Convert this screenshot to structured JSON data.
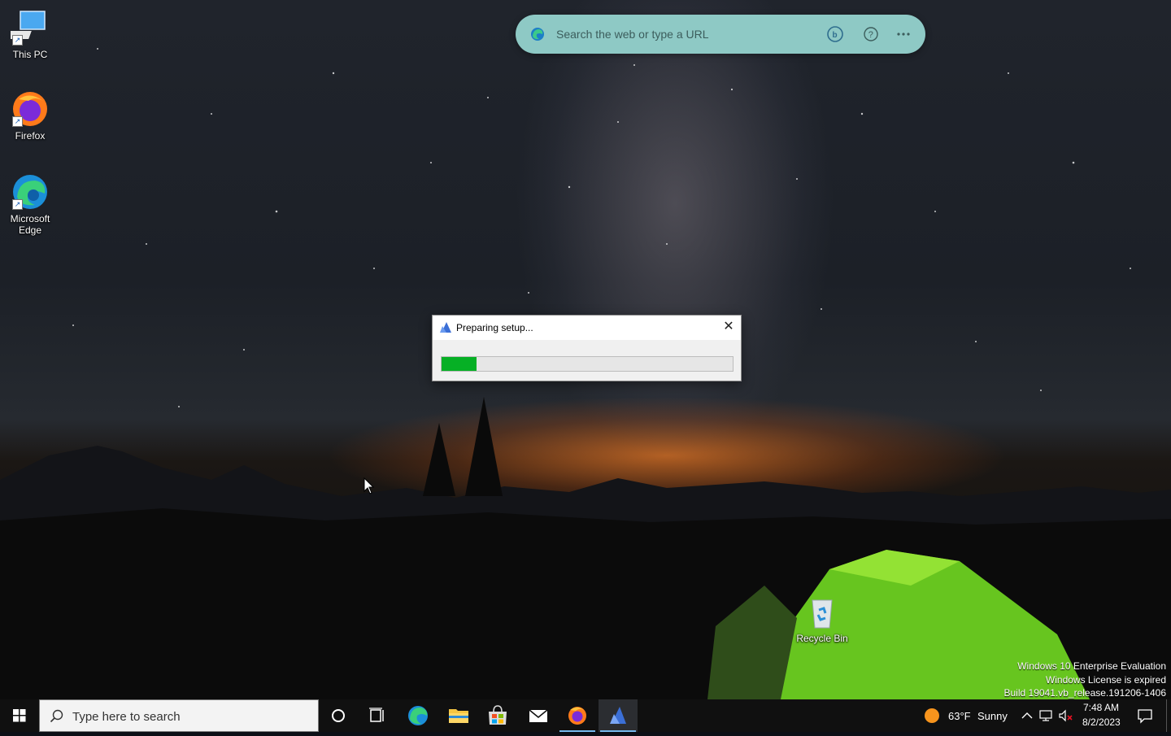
{
  "desktop": {
    "icons": [
      {
        "label": "This PC",
        "icon": "this-pc-icon"
      },
      {
        "label": "Firefox",
        "icon": "firefox-icon"
      },
      {
        "label": "Microsoft Edge",
        "icon": "edge-icon"
      },
      {
        "label": "Recycle Bin",
        "icon": "recycle-bin-icon"
      }
    ]
  },
  "edge_bar": {
    "placeholder": "Search the web or type a URL",
    "icons": [
      "edge-icon",
      "bing-chat-icon",
      "help-icon",
      "more-options-icon"
    ]
  },
  "dialog": {
    "title": "Preparing setup...",
    "close_glyph": "✕",
    "progress": 0.12,
    "progress_color": "#06b025"
  },
  "watermark": {
    "line1": "Windows 10 Enterprise Evaluation",
    "line2": "Windows License is expired",
    "line3": "Build 19041.vb_release.191206-1406"
  },
  "taskbar": {
    "search_placeholder": "Type here to search",
    "apps": [
      "cortana-icon",
      "task-view-icon",
      "edge-icon",
      "file-explorer-icon",
      "store-icon",
      "mail-icon",
      "firefox-icon",
      "setup-app-icon"
    ],
    "weather": {
      "temp": "63°F",
      "condition": "Sunny"
    },
    "time": "7:48 AM",
    "date": "8/2/2023"
  }
}
